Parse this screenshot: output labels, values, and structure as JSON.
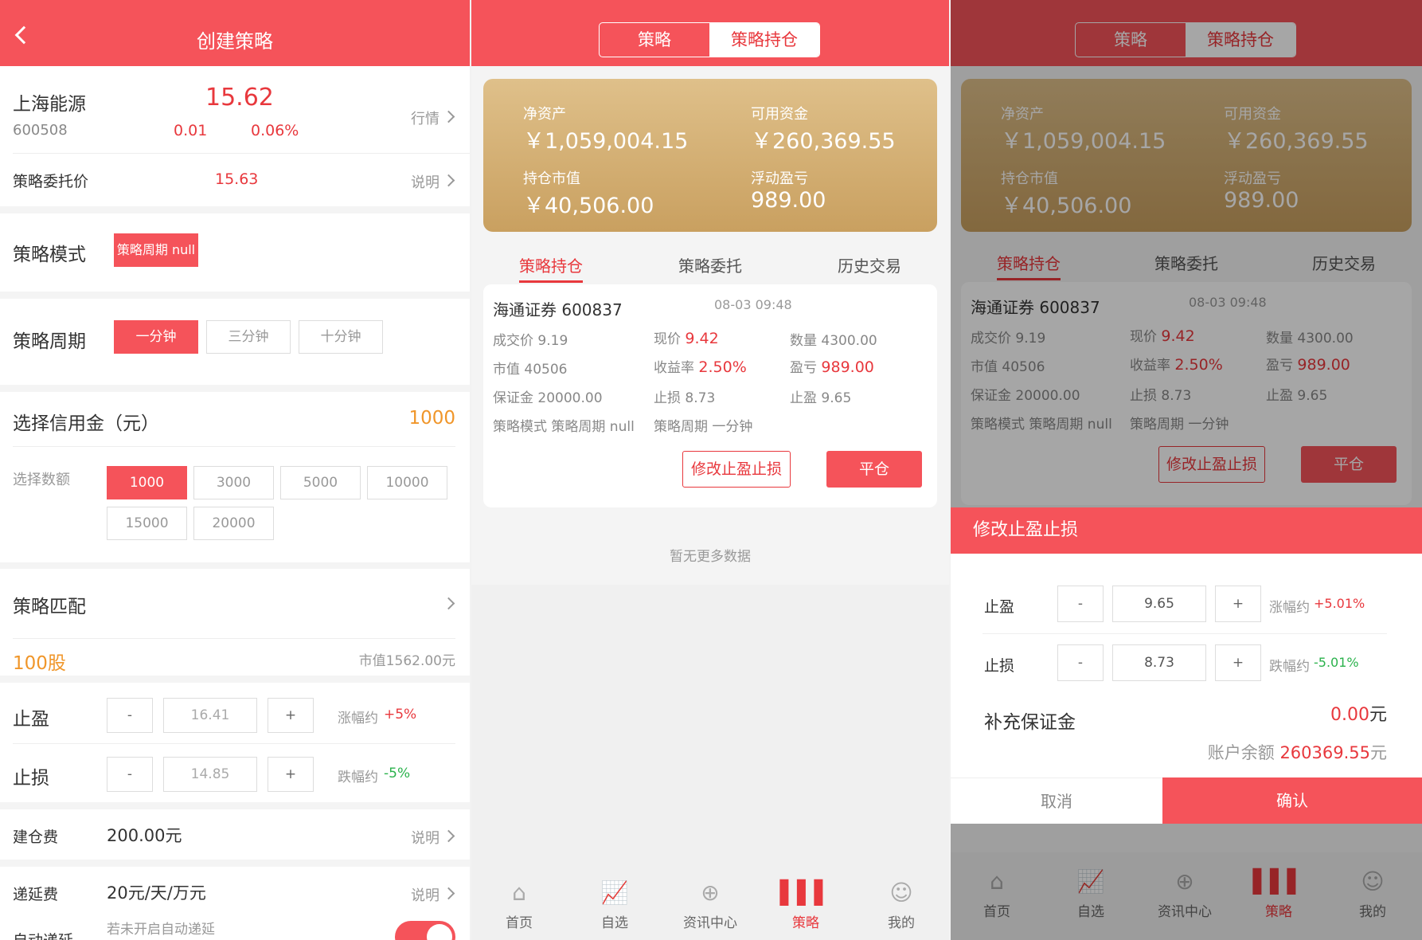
{
  "p1": {
    "title": "创建策略",
    "stock_name": "上海能源",
    "stock_code": "600508",
    "price": "15.62",
    "change": "0.01",
    "change_pct": "0.06%",
    "quote_link": "行情",
    "order_price_label": "策略委托价",
    "order_price": "15.63",
    "explain": "说明",
    "mode_label": "策略模式",
    "mode_value": "策略周期 null",
    "period_label": "策略周期",
    "periods": [
      "一分钟",
      "三分钟",
      "十分钟"
    ],
    "credit_label": "选择信用金（元）",
    "credit_value": "1000",
    "amount_label": "选择数额",
    "amounts": [
      "1000",
      "3000",
      "5000",
      "10000",
      "15000",
      "20000"
    ],
    "match_label": "策略匹配",
    "shares": "100股",
    "market_value": "市值1562.00元",
    "tp_label": "止盈",
    "tp_minus": "-",
    "tp_value": "16.41",
    "tp_plus": "+",
    "tp_rise_label": "涨幅约",
    "tp_rise": "+5%",
    "sl_label": "止损",
    "sl_minus": "-",
    "sl_value": "14.85",
    "sl_plus": "+",
    "sl_fall_label": "跌幅约",
    "sl_fall": "-5%",
    "fee_label": "建仓费",
    "fee_value": "200.00元",
    "defer_label": "递延费",
    "defer_value": "20元/天/万元",
    "auto_label": "自动递延",
    "auto_hint": "若未开启自动递延"
  },
  "p2": {
    "seg_strategy": "策略",
    "seg_holdings": "策略持仓",
    "net_assets_label": "净资产",
    "net_assets": "￥1,059,004.15",
    "available_label": "可用资金",
    "available": "￥260,369.55",
    "holding_value_label": "持仓市值",
    "holding_value": "￥40,506.00",
    "float_pl_label": "浮动盈亏",
    "float_pl": "989.00",
    "tab_holdings": "策略持仓",
    "tab_orders": "策略委托",
    "tab_history": "历史交易",
    "card": {
      "name": "海通证券 600837",
      "time": "08-03 09:48",
      "deal_label": "成交价",
      "deal": "9.19",
      "now_label": "现价",
      "now": "9.42",
      "qty_label": "数量",
      "qty": "4300.00",
      "mv_label": "市值",
      "mv": "40506",
      "yield_label": "收益率",
      "yield": "2.50%",
      "pl_label": "盈亏",
      "pl": "989.00",
      "margin_label": "保证金",
      "margin": "20000.00",
      "sl_label": "止损",
      "sl": "8.73",
      "tp_label": "止盈",
      "tp": "9.65",
      "mode_label": "策略模式",
      "mode": "策略周期 null",
      "period_label": "策略周期",
      "period": "一分钟",
      "modify_btn": "修改止盈止损",
      "close_btn": "平仓"
    },
    "no_more": "暂无更多数据",
    "nav": [
      "首页",
      "自选",
      "资讯中心",
      "策略",
      "我的"
    ]
  },
  "p3": {
    "modal_title": "修改止盈止损",
    "tp_label": "止盈",
    "tp_value": "9.65",
    "tp_rise_label": "涨幅约",
    "tp_rise": "+5.01%",
    "sl_label": "止损",
    "sl_value": "8.73",
    "sl_fall_label": "跌幅约",
    "sl_fall": "-5.01%",
    "minus": "-",
    "plus": "+",
    "supp_label": "补充保证金",
    "supp_value": "0.00",
    "supp_unit": "元",
    "balance_label": "账户余额",
    "balance": "260369.55",
    "balance_unit": "元",
    "cancel": "取消",
    "confirm": "确认"
  },
  "icons": {
    "home": "home-icon",
    "watch": "chart-icon",
    "news": "plus-circle-icon",
    "strategy": "bars-icon",
    "me": "user-icon"
  },
  "colors": {
    "brand": "#f5535a",
    "up": "#e8383d",
    "down": "#2bb24c",
    "accent": "#f0962a",
    "gold": "#d4af72"
  }
}
